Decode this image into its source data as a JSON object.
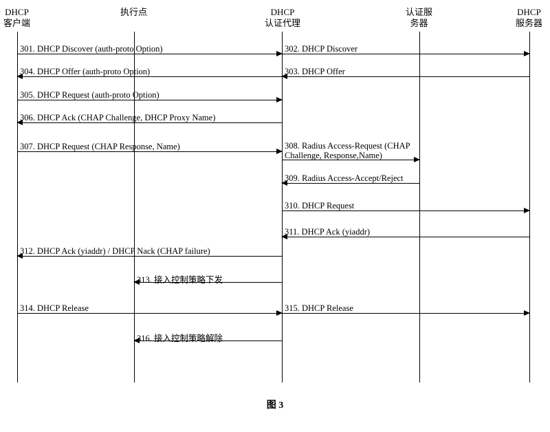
{
  "actors": {
    "a0": "DHCP\n客户端",
    "a1": "执行点",
    "a2": "DHCP\n认证代理",
    "a3": "认证服\n务器",
    "a4": "DHCP\n服务器"
  },
  "messages": {
    "m301": "301. DHCP Discover (auth-proto Option)",
    "m302": "302. DHCP Discover",
    "m303": "303. DHCP Offer",
    "m304": "304. DHCP Offer (auth-proto Option)",
    "m305": "305. DHCP Request (auth-proto Option)",
    "m306": "306. DHCP Ack (CHAP Challenge, DHCP Proxy Name)",
    "m307": "307. DHCP Request (CHAP Response, Name)",
    "m308": "308. Radius Access-Request (CHAP Challenge, Response,Name)",
    "m309": "309. Radius Access-Accept/Reject",
    "m310": "310. DHCP Request",
    "m311": "311. DHCP Ack (yiaddr)",
    "m312": "312. DHCP Ack (yiaddr) / DHCP Nack (CHAP failure)",
    "m313": "313. 接入控制策略下发",
    "m314": "314. DHCP Release",
    "m315": "315. DHCP Release",
    "m316": "316. 接入控制策略解除"
  },
  "caption": "图 3"
}
